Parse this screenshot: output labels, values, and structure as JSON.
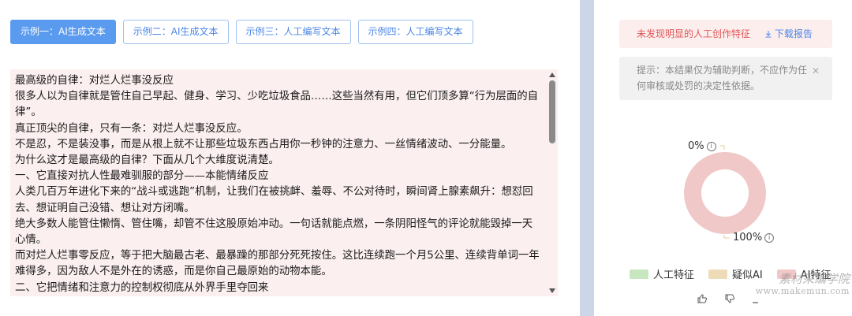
{
  "tabs": [
    {
      "label": "示例一：AI生成文本",
      "active": true
    },
    {
      "label": "示例二：AI生成文本",
      "active": false
    },
    {
      "label": "示例三：人工编写文本",
      "active": false
    },
    {
      "label": "示例四：人工编写文本",
      "active": false
    }
  ],
  "text_lines": [
    "最高级的自律：对烂人烂事没反应",
    "很多人以为自律就是管住自己早起、健身、学习、少吃垃圾食品……这些当然有用，但它们顶多算“行为层面的自律”。",
    "真正顶尖的自律，只有一条：对烂人烂事没反应。",
    "不是忍，不是装没事，而是从根上就不让那些垃圾东西占用你一秒钟的注意力、一丝情绪波动、一分能量。",
    "为什么这才是最高级的自律？下面从几个大维度说清楚。",
    "一、它直接对抗人性最难驯服的部分——本能情绪反应",
    "人类几百万年进化下来的“战斗或逃跑”机制，让我们在被挑衅、羞辱、不公对待时，瞬间肾上腺素飙升：想怼回去、想证明自己没错、想让对方闭嘴。",
    "绝大多数人能管住懒惰、管住嘴，却管不住这股原始冲动。一句话就能点燃，一条阴阳怪气的评论就能毁掉一天心情。",
    "而对烂人烂事零反应，等于把大脑最古老、最暴躁的那部分死死按住。这比连续跑一个月5公里、连续背单词一年难得多，因为敌人不是外在的诱惑，而是你自己最原始的动物本能。",
    "二、它把情绪和注意力的控制权彻底从外界手里夺回来"
  ],
  "alert": {
    "message": "未发现明显的人工创作特征",
    "download": "下载报告",
    "download_icon": "download-icon"
  },
  "hint": {
    "text": "提示：本结果仅为辅助判断，不应作为任何审核或处罚的决定性依据。",
    "close_icon": "close-icon"
  },
  "colors": {
    "accent": "#5b9bef",
    "human": "#c8e6c0",
    "suspect_ai": "#eedcb8",
    "ai": "#f0c8c8"
  },
  "chart_data": {
    "type": "pie",
    "donut": true,
    "categories": [
      "人工特征",
      "疑似AI",
      "AI特征"
    ],
    "values": [
      0,
      0,
      100
    ],
    "data_labels": [
      "0%",
      "100%"
    ],
    "legend_position": "bottom"
  },
  "legend": [
    "人工特征",
    "疑似AI",
    "AI特征"
  ],
  "watermark": {
    "text": "素材采编学院",
    "url": "www.makemun.com"
  },
  "feedback": {
    "like_icon": "thumbs-up-icon",
    "dislike_icon": "thumbs-down-icon",
    "copy_icon": "copy-icon"
  }
}
